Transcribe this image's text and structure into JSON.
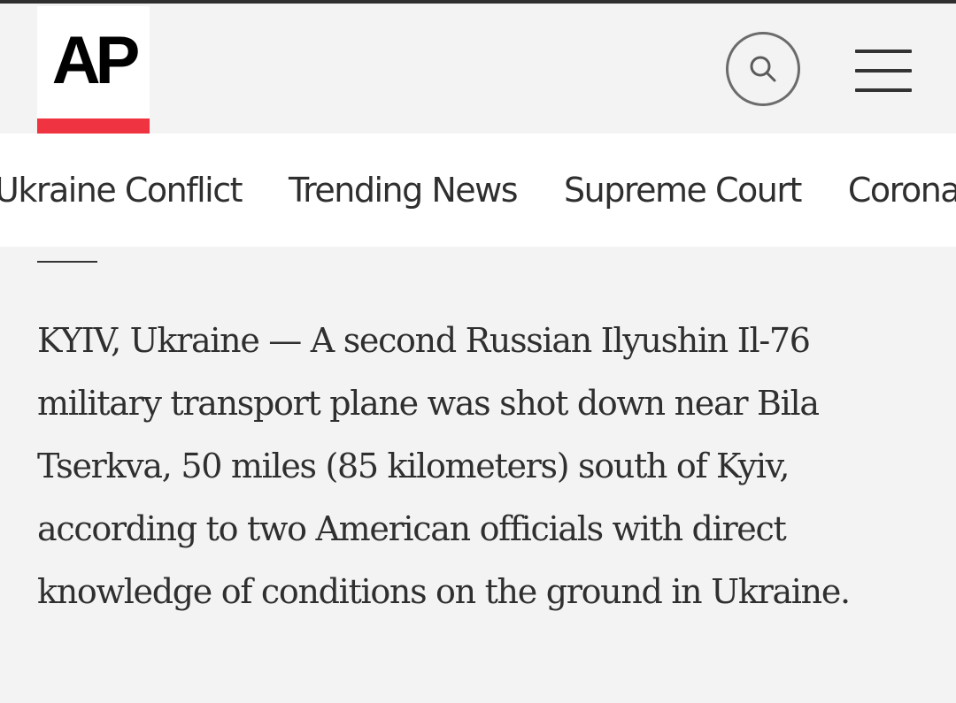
{
  "header": {
    "logo_text": "AP",
    "logo_accent_color": "#ef3340",
    "search_icon": "search-icon",
    "menu_icon": "hamburger-menu-icon"
  },
  "nav": {
    "items": [
      {
        "label": "Ukraine Conflict"
      },
      {
        "label": "Trending News"
      },
      {
        "label": "Supreme Court"
      },
      {
        "label": "Coronavirus"
      }
    ]
  },
  "article": {
    "lead": "KYIV, Ukraine — A second Russian Ilyushin Il-76 military transport plane was shot down near Bila Tserkva, 50 miles (85 kilometers) south of Kyiv, according to two American officials with direct knowledge of conditions on the ground in Ukraine."
  }
}
